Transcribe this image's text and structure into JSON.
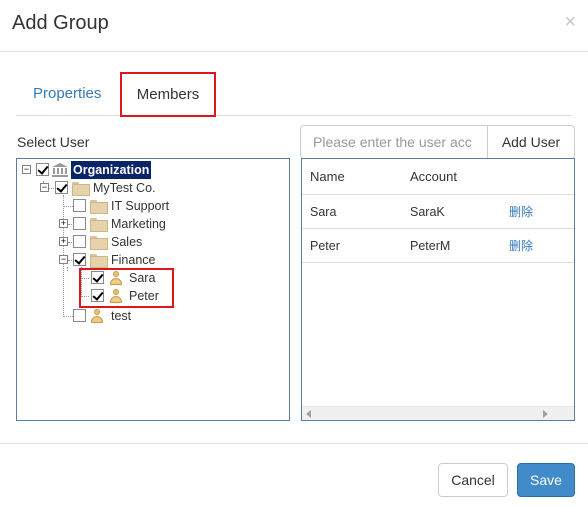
{
  "dialog": {
    "title": "Add Group",
    "close_glyph": "×"
  },
  "tabs": [
    {
      "label": "Properties",
      "active": false
    },
    {
      "label": "Members",
      "active": true
    }
  ],
  "select_user_label": "Select User",
  "tree": {
    "root": {
      "label": "Organization",
      "checked": true,
      "expander": "−",
      "icon": "organization-icon"
    },
    "company": {
      "label": "MyTest Co.",
      "checked": true,
      "expander": "−",
      "icon": "folder-icon"
    },
    "departments": [
      {
        "label": "IT Support",
        "checked": false,
        "expander": "",
        "icon": "folder-icon"
      },
      {
        "label": "Marketing",
        "checked": false,
        "expander": "+",
        "icon": "folder-icon"
      },
      {
        "label": "Sales",
        "checked": false,
        "expander": "+",
        "icon": "folder-icon"
      },
      {
        "label": "Finance",
        "checked": true,
        "expander": "−",
        "icon": "folder-icon"
      }
    ],
    "finance_users": [
      {
        "label": "Sara",
        "checked": true,
        "icon": "user-icon"
      },
      {
        "label": "Peter",
        "checked": true,
        "icon": "user-icon"
      }
    ],
    "other_users": [
      {
        "label": "test",
        "checked": false,
        "icon": "user-icon"
      }
    ]
  },
  "search": {
    "placeholder": "Please enter the user acc",
    "value": ""
  },
  "add_user_label": "Add User",
  "grid": {
    "columns": [
      "Name",
      "Account"
    ],
    "rows": [
      {
        "name": "Sara",
        "account": "SaraK",
        "action": "删除"
      },
      {
        "name": "Peter",
        "account": "PeterM",
        "action": "删除"
      }
    ]
  },
  "footer": {
    "cancel_label": "Cancel",
    "save_label": "Save"
  },
  "colors": {
    "accent": "#428bca",
    "link": "#337ab7",
    "highlight": "#d9171d",
    "selection": "#0a246a"
  }
}
